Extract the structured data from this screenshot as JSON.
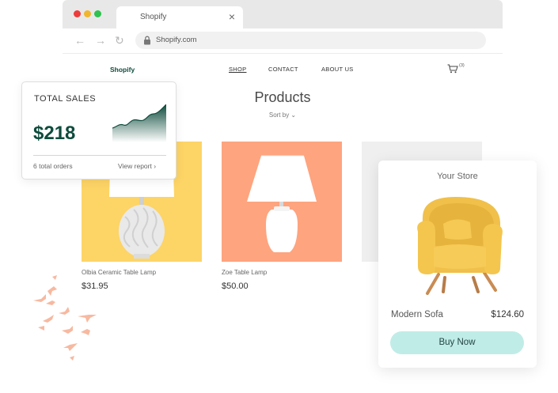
{
  "browser": {
    "tab_title": "Shopify",
    "url": "Shopify.com"
  },
  "store": {
    "logo": "Shopify",
    "nav": [
      "SHOP",
      "CONTACT",
      "ABOUT US"
    ],
    "cart_count": "(3)",
    "page_title": "Products",
    "sort_label": "Sort by ⌄"
  },
  "products": [
    {
      "name": "Olbia Ceramic Table Lamp",
      "price": "$31.95"
    },
    {
      "name": "Zoe Table Lamp",
      "price": "$50.00"
    }
  ],
  "sales_card": {
    "title": "TOTAL SALES",
    "value": "$218",
    "orders": "6 total orders",
    "report_link": "View report  ›"
  },
  "store_card": {
    "title": "Your Store",
    "product_name": "Modern Sofa",
    "price": "$124.60",
    "button": "Buy Now"
  },
  "colors": {
    "brand": "#0e4c3c",
    "product1_bg": "#fdd466",
    "product2_bg": "#fea47f",
    "buy_button": "#c0ece7"
  }
}
